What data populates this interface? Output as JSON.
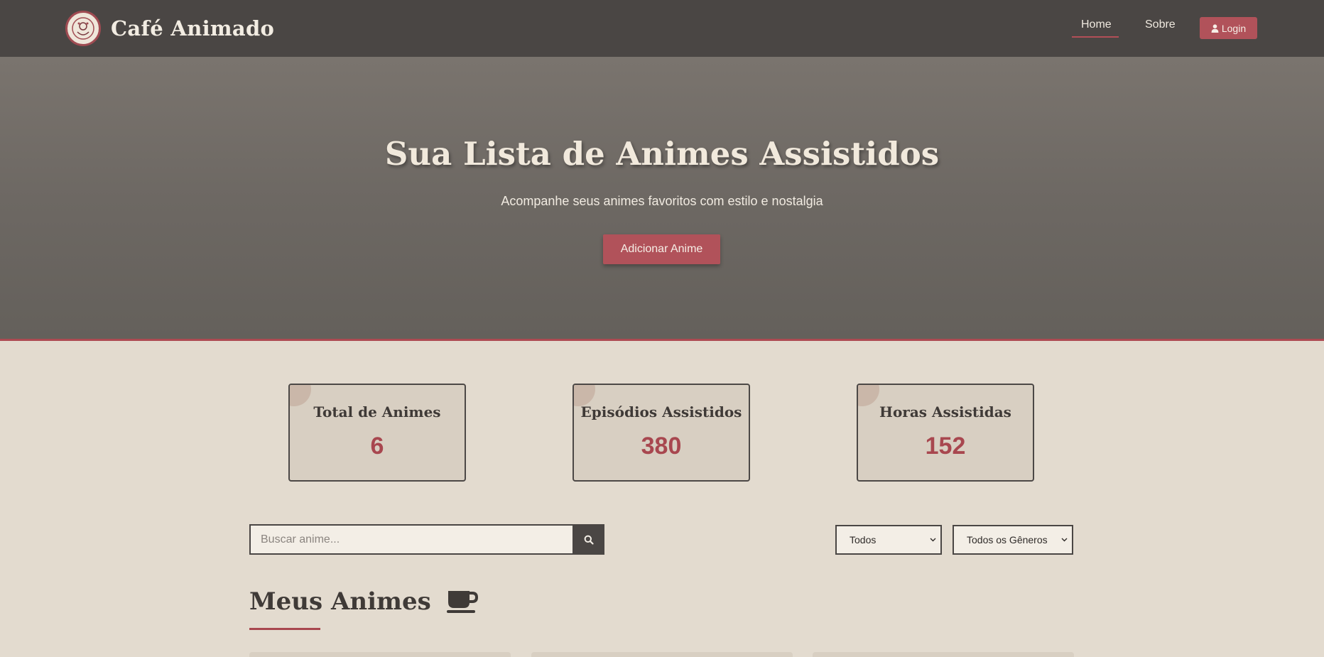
{
  "navbar": {
    "brand": "Café Animado",
    "links": [
      {
        "label": "Home",
        "active": true
      },
      {
        "label": "Sobre",
        "active": false
      }
    ],
    "login_label": "Login"
  },
  "hero": {
    "title": "Sua Lista de Animes Assistidos",
    "subtitle": "Acompanhe seus animes favoritos com estilo e nostalgia",
    "button_label": "Adicionar Anime"
  },
  "stats": [
    {
      "title": "Total de Animes",
      "value": "6"
    },
    {
      "title": "Episódios Assistidos",
      "value": "380"
    },
    {
      "title": "Horas Assistidas",
      "value": "152"
    }
  ],
  "search": {
    "placeholder": "Buscar anime...",
    "value": ""
  },
  "filters": {
    "status": {
      "selected": "Todos"
    },
    "genre": {
      "selected": "Todos os Gêneros"
    }
  },
  "section": {
    "title": "Meus Animes",
    "icon": "coffee-cup-icon"
  },
  "colors": {
    "navbar_bg": "#4a4644",
    "accent": "#b1525a",
    "page_bg": "#efe9df",
    "card_bg": "#d8cfc2"
  }
}
